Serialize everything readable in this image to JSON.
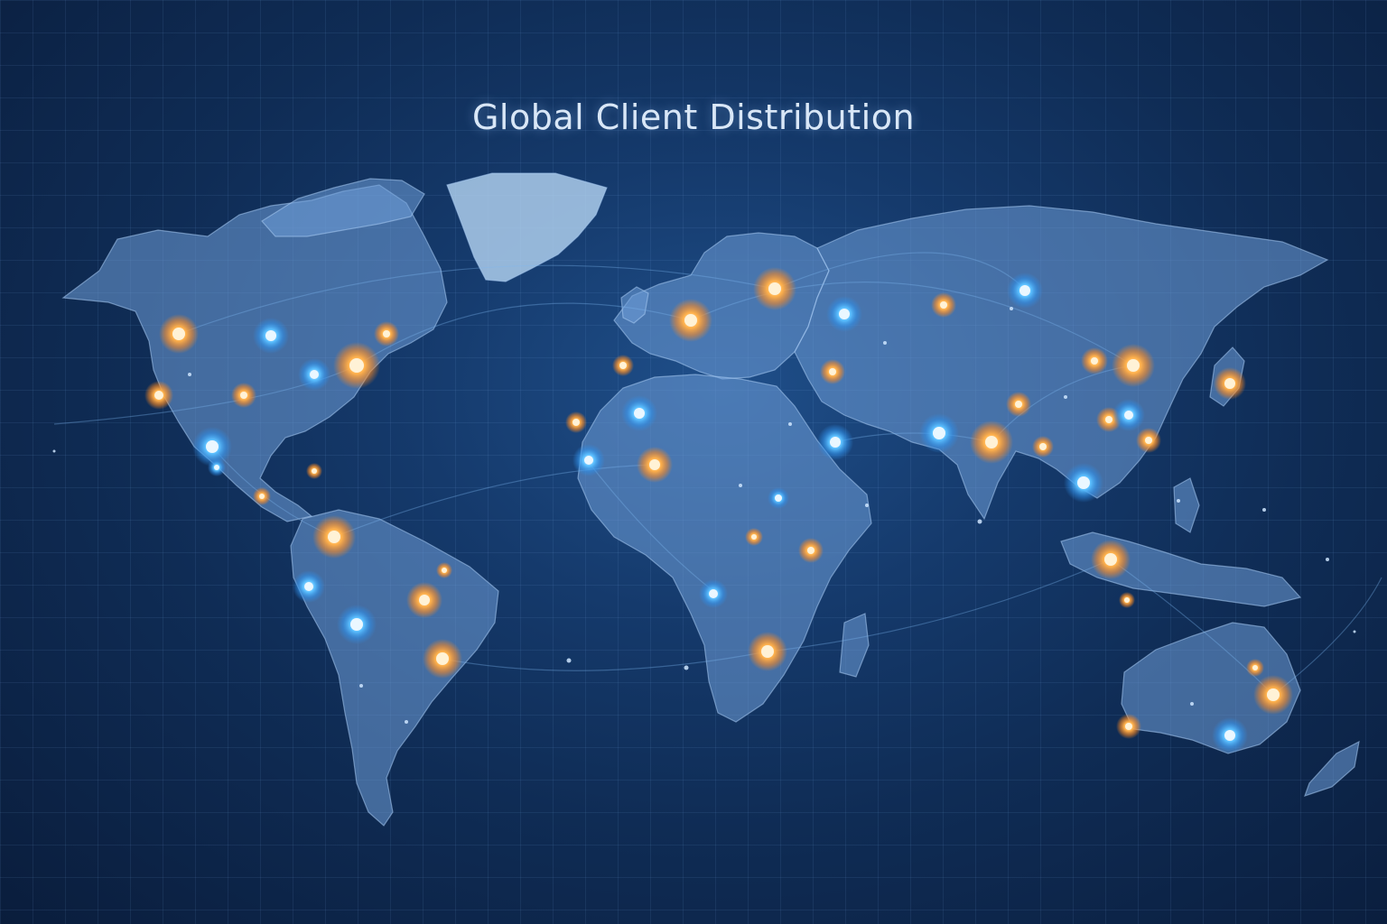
{
  "title": "Global Client Distribution",
  "colors": {
    "client_marker_orange": "#ff9b3d",
    "client_marker_blue": "#4fb2ff",
    "land": "#6f9fd9",
    "background": "#0f2c55"
  },
  "icons": {
    "orange_marker": "glowing-orange-pin",
    "blue_marker": "glowing-blue-pin"
  }
}
